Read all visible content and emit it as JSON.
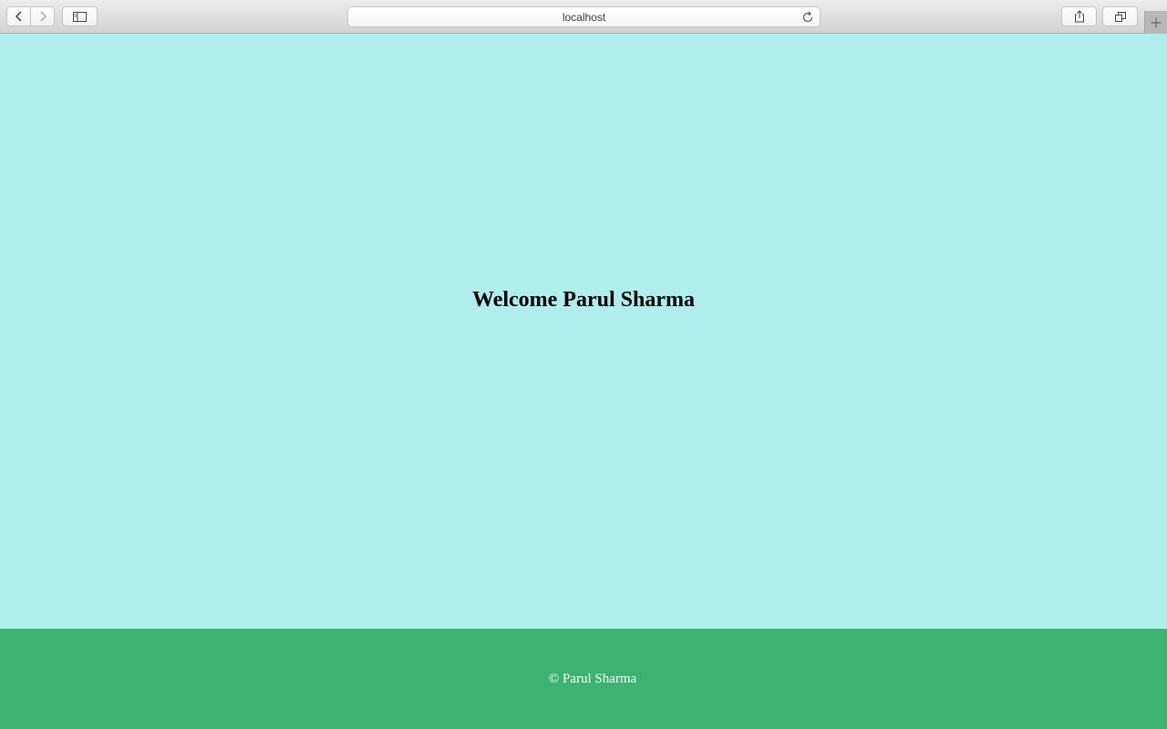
{
  "browser": {
    "address": "localhost",
    "icons": {
      "back": "chevron-left-icon",
      "forward": "chevron-right-icon",
      "sidebar": "sidebar-icon",
      "reload": "reload-icon",
      "share": "share-icon",
      "tabs": "tabs-overview-icon",
      "new_tab": "plus-icon"
    }
  },
  "main": {
    "heading": "Welcome Parul Sharma",
    "background": "#b0eeee"
  },
  "footer": {
    "text": "© Parul Sharma",
    "background": "#3cb471"
  }
}
